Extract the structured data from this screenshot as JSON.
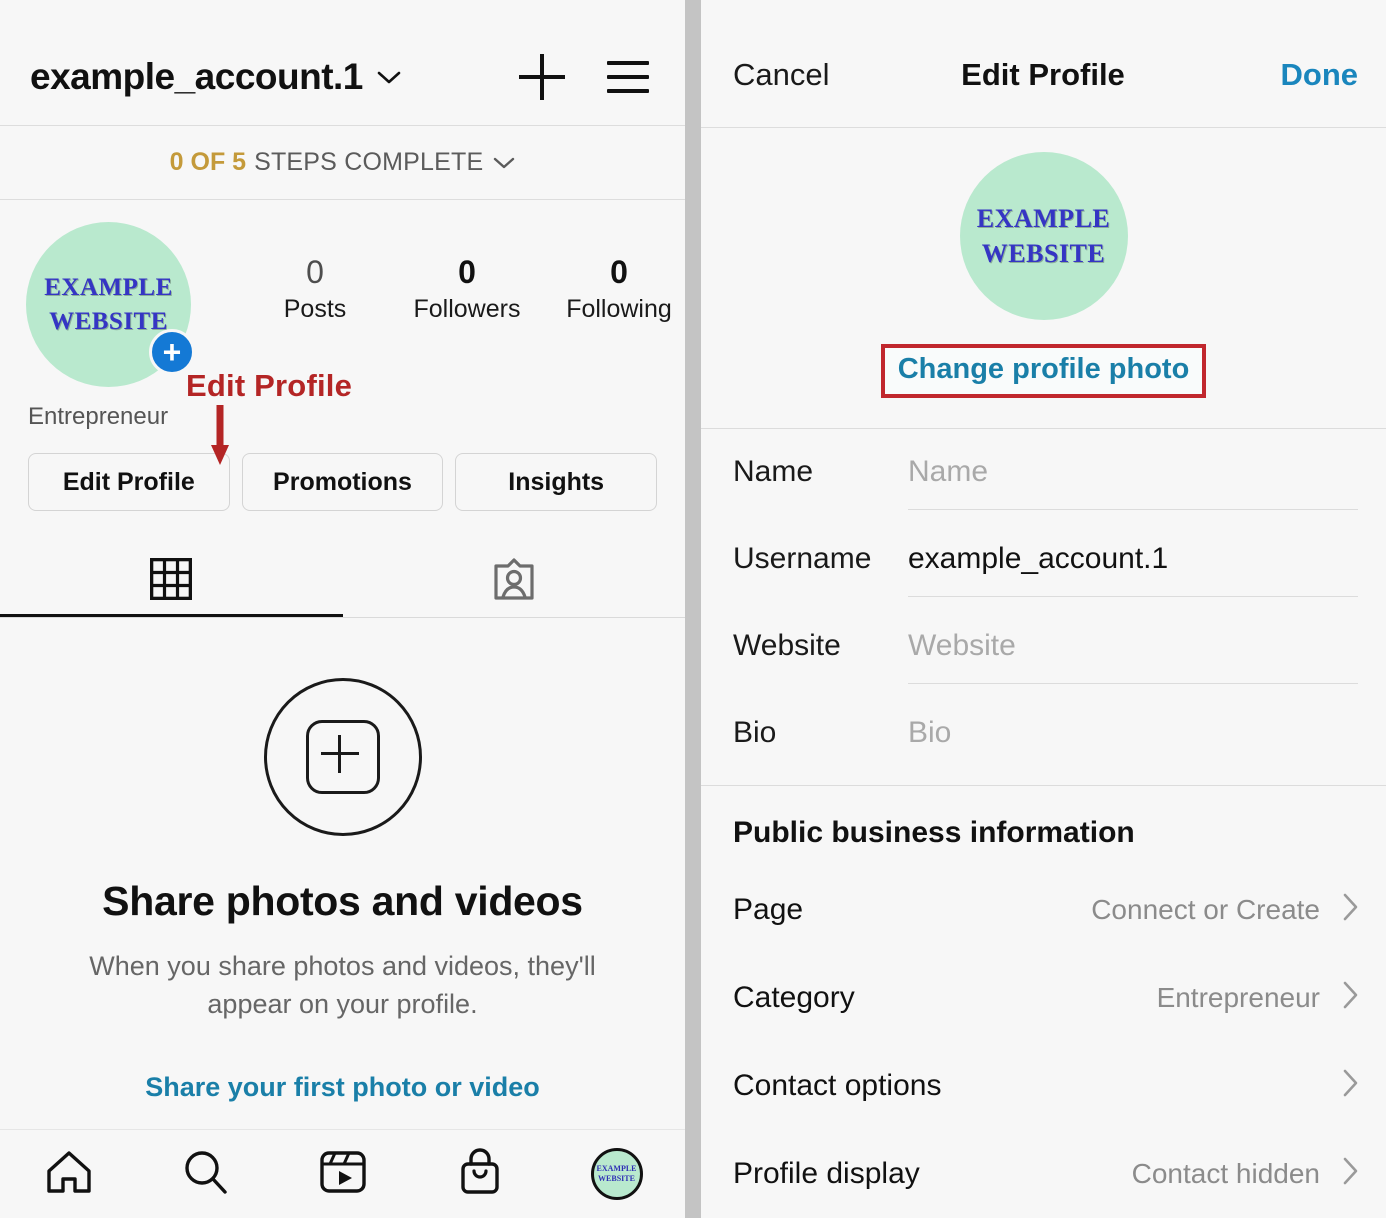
{
  "left": {
    "header": {
      "username": "example_account.1",
      "chevron_icon": "chevron-down-icon",
      "add_icon": "plus-icon",
      "menu_icon": "hamburger-menu-icon"
    },
    "steps": {
      "count": "0 OF 5",
      "label": "STEPS COMPLETE",
      "chevron_icon": "chevron-down-icon"
    },
    "profile": {
      "avatar_line1": "EXAMPLE",
      "avatar_line2": "WEBSITE",
      "avatar_badge": "+",
      "category": "Entrepreneur",
      "stats": [
        {
          "value": "0",
          "label": "Posts"
        },
        {
          "value": "0",
          "label": "Followers"
        },
        {
          "value": "0",
          "label": "Following"
        }
      ]
    },
    "annotation": {
      "text": "Edit Profile",
      "color": "#b42525",
      "arrow_icon": "down-arrow-icon"
    },
    "buttons": [
      {
        "label": "Edit Profile"
      },
      {
        "label": "Promotions"
      },
      {
        "label": "Insights"
      }
    ],
    "tabs": [
      {
        "icon": "grid-icon",
        "active": true
      },
      {
        "icon": "tagged-person-icon",
        "active": false
      }
    ],
    "empty_state": {
      "icon": "plus-in-circle-icon",
      "title": "Share photos and videos",
      "subtitle": "When you share photos and videos, they'll appear on your profile.",
      "link": "Share your first photo or video"
    },
    "bottom_nav": [
      {
        "icon": "home-icon"
      },
      {
        "icon": "search-icon"
      },
      {
        "icon": "reels-icon"
      },
      {
        "icon": "shop-bag-icon"
      },
      {
        "icon": "profile-avatar-icon",
        "line1": "EXAMPLE",
        "line2": "WEBSITE"
      }
    ]
  },
  "right": {
    "header": {
      "cancel": "Cancel",
      "title": "Edit Profile",
      "done": "Done"
    },
    "photo": {
      "avatar_line1": "EXAMPLE",
      "avatar_line2": "WEBSITE",
      "change_label": "Change profile photo",
      "highlight_color": "#c1272d"
    },
    "fields": [
      {
        "label": "Name",
        "value": "Name",
        "is_placeholder": true
      },
      {
        "label": "Username",
        "value": "example_account.1",
        "is_placeholder": false
      },
      {
        "label": "Website",
        "value": "Website",
        "is_placeholder": true
      },
      {
        "label": "Bio",
        "value": "Bio",
        "is_placeholder": true
      }
    ],
    "business": {
      "title": "Public business information",
      "rows": [
        {
          "label": "Page",
          "value": "Connect or Create",
          "chevron_icon": "chevron-right-icon"
        },
        {
          "label": "Category",
          "value": "Entrepreneur",
          "chevron_icon": "chevron-right-icon"
        },
        {
          "label": "Contact options",
          "value": "",
          "chevron_icon": "chevron-right-icon"
        },
        {
          "label": "Profile display",
          "value": "Contact hidden",
          "chevron_icon": "chevron-right-icon"
        }
      ]
    }
  }
}
